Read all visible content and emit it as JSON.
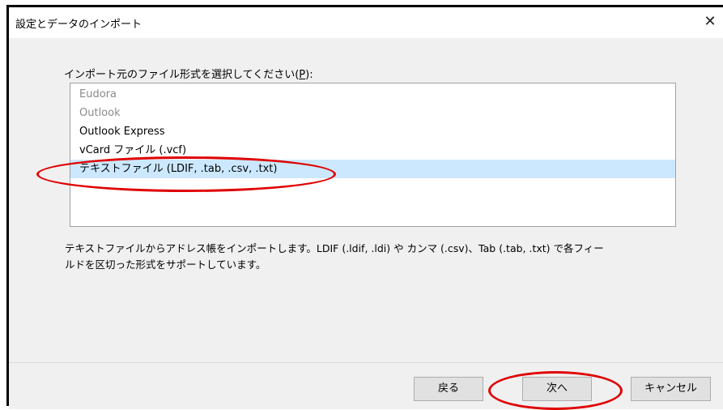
{
  "window": {
    "title": "設定とデータのインポート",
    "close_symbol": "✕"
  },
  "prompt": {
    "text_before": "インポート元のファイル形式を選択してください(",
    "accelerator": "P",
    "text_after": "):"
  },
  "list": {
    "items": [
      {
        "label": "Eudora",
        "state": "disabled"
      },
      {
        "label": "Outlook",
        "state": "disabled"
      },
      {
        "label": "Outlook Express",
        "state": "normal"
      },
      {
        "label": "vCard ファイル (.vcf)",
        "state": "normal"
      },
      {
        "label": "テキストファイル (LDIF, .tab, .csv, .txt)",
        "state": "selected"
      }
    ]
  },
  "description": {
    "line1": "テキストファイルからアドレス帳をインポートします。LDIF (.ldif, .ldi) や カンマ (.csv)、Tab (.tab, .txt) で各フィー",
    "line2": "ルドを区切った形式をサポートしています。"
  },
  "buttons": {
    "back": "戻る",
    "next": "次へ",
    "cancel": "キャンセル"
  },
  "colors": {
    "selection": "#cce8ff",
    "annotation": "#e00000",
    "disabled_text": "#8a8a8a"
  }
}
